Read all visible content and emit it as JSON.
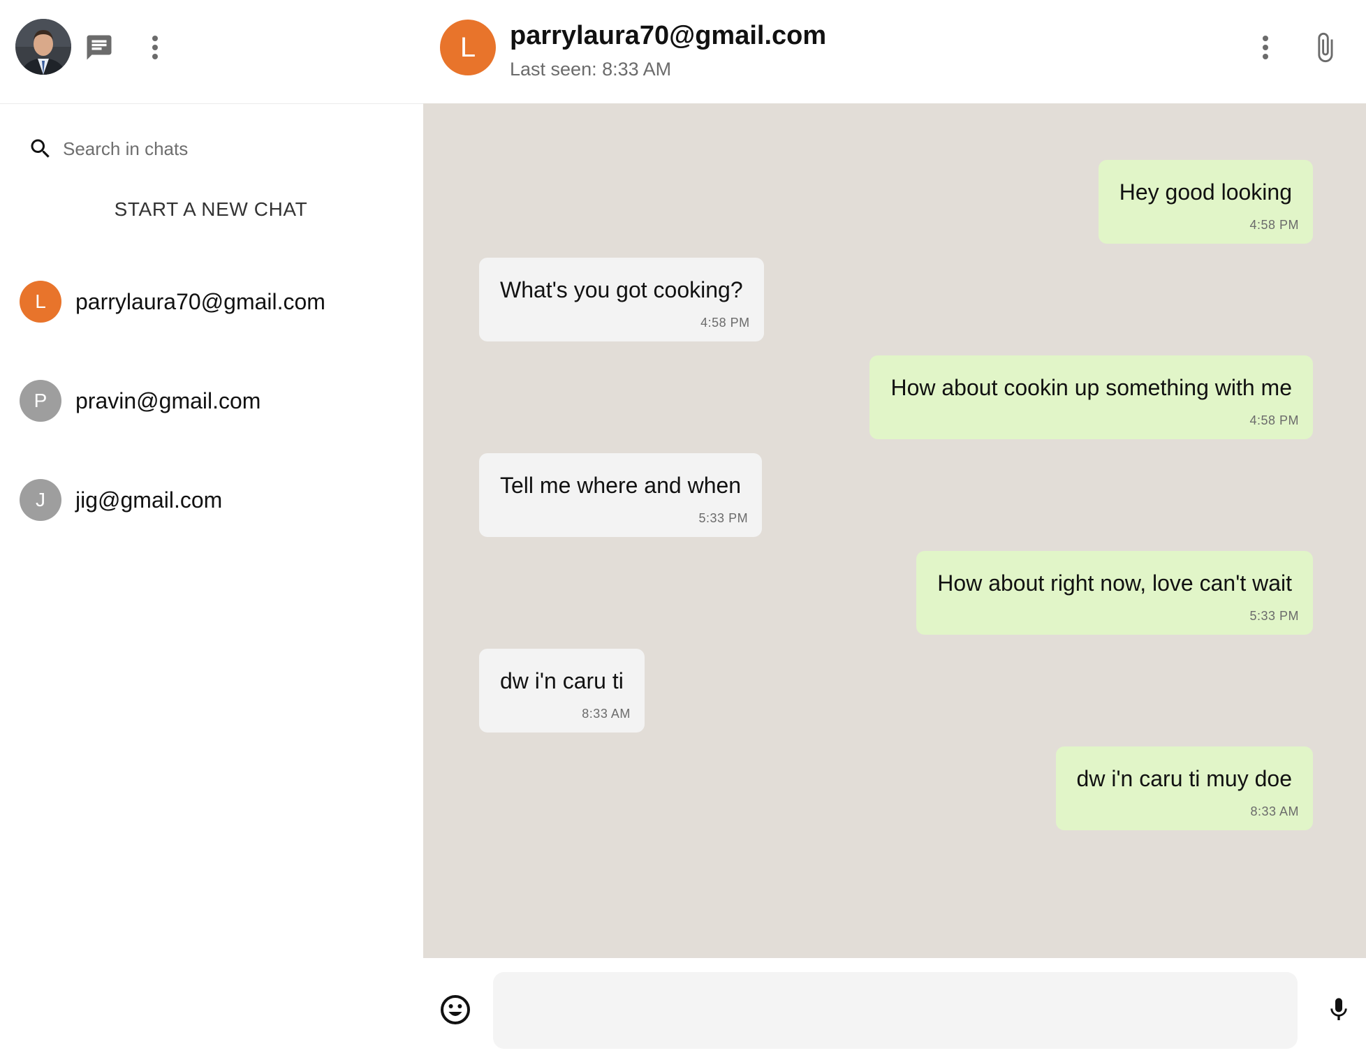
{
  "sidebar": {
    "search": {
      "placeholder": "Search in chats",
      "value": ""
    },
    "new_chat_label": "START A NEW CHAT",
    "contacts": [
      {
        "initial": "L",
        "name": "parrylaura70@gmail.com",
        "color": "#e8742b"
      },
      {
        "initial": "P",
        "name": "pravin@gmail.com",
        "color": "#9e9e9e"
      },
      {
        "initial": "J",
        "name": "jig@gmail.com",
        "color": "#9e9e9e"
      }
    ],
    "icons": [
      "user-avatar",
      "chat-icon",
      "more-vert-icon",
      "search-icon"
    ]
  },
  "chat": {
    "avatar_initial": "L",
    "avatar_color": "#e8742b",
    "title": "parrylaura70@gmail.com",
    "status": "Last seen: 8:33 AM",
    "messages": [
      {
        "direction": "out",
        "text": "Hey good looking",
        "time": "4:58 PM"
      },
      {
        "direction": "in",
        "text": "What's you got cooking?",
        "time": "4:58 PM"
      },
      {
        "direction": "out",
        "text": "How about cookin up something with me",
        "time": "4:58 PM"
      },
      {
        "direction": "in",
        "text": "Tell me where and when",
        "time": "5:33 PM"
      },
      {
        "direction": "out",
        "text": "How about right now, love can't wait",
        "time": "5:33 PM"
      },
      {
        "direction": "in",
        "text": "dw i'n caru ti",
        "time": "8:33 AM"
      },
      {
        "direction": "out",
        "text": "dw i'n caru ti muy doe",
        "time": "8:33 AM"
      }
    ],
    "composer": {
      "value": "",
      "placeholder": ""
    },
    "icons": [
      "more-vert-icon",
      "attach-icon",
      "emoji-icon",
      "mic-icon"
    ]
  },
  "colors": {
    "chat_background": "#e2ddd7",
    "incoming_bubble": "#f3f3f3",
    "outgoing_bubble": "#e1f5c8"
  }
}
